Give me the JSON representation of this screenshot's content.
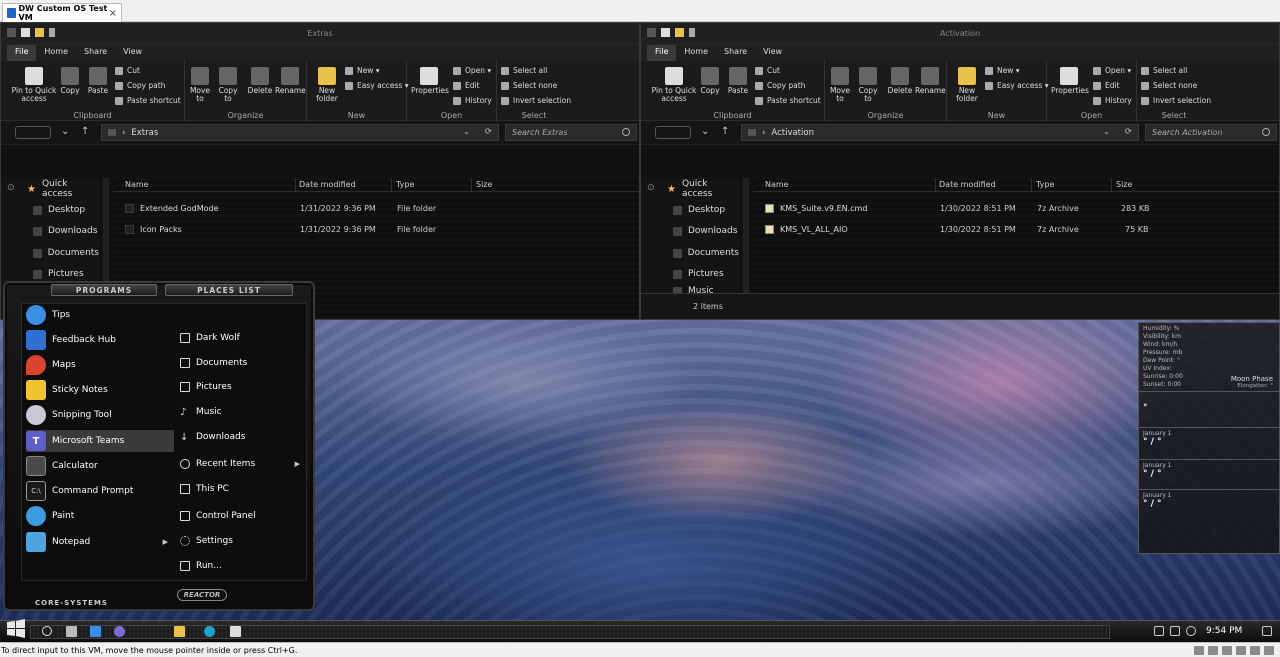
{
  "vm": {
    "tab_title": "DW Custom OS Test VM",
    "status_text": "To direct input to this VM, move the mouse pointer inside or press Ctrl+G."
  },
  "ribbon": {
    "tabs": [
      "File",
      "Home",
      "Share",
      "View"
    ],
    "clipboard": {
      "pin": "Pin to Quick access",
      "copy": "Copy",
      "paste": "Paste",
      "cut": "Cut",
      "copy_path": "Copy path",
      "paste_shortcut": "Paste shortcut",
      "label": "Clipboard"
    },
    "organize": {
      "move_to": "Move to",
      "copy_to": "Copy to",
      "delete": "Delete",
      "rename": "Rename",
      "label": "Organize"
    },
    "new": {
      "new_folder": "New folder",
      "new_item": "New ▾",
      "easy_access": "Easy access ▾",
      "label": "New"
    },
    "open": {
      "properties": "Properties",
      "open": "Open ▾",
      "edit": "Edit",
      "history": "History",
      "label": "Open"
    },
    "select": {
      "select_all": "Select all",
      "select_none": "Select none",
      "invert": "Invert selection",
      "label": "Select"
    }
  },
  "columns": {
    "name": "Name",
    "date": "Date modified",
    "type": "Type",
    "size": "Size"
  },
  "explorer_left": {
    "title": "Extras",
    "address": "Extras",
    "search_placeholder": "Search Extras",
    "nav": [
      "Quick access",
      "Desktop",
      "Downloads",
      "Documents",
      "Pictures"
    ],
    "files": [
      {
        "name": "Extended GodMode",
        "date": "1/31/2022 9:36 PM",
        "type": "File folder",
        "size": ""
      },
      {
        "name": "Icon Packs",
        "date": "1/31/2022 9:36 PM",
        "type": "File folder",
        "size": ""
      }
    ]
  },
  "explorer_right": {
    "title": "Activation",
    "address": "Activation",
    "search_placeholder": "Search Activation",
    "nav": [
      "Quick access",
      "Desktop",
      "Downloads",
      "Documents",
      "Pictures",
      "Music"
    ],
    "files": [
      {
        "name": "KMS_Suite.v9.EN.cmd",
        "date": "1/30/2022 8:51 PM",
        "type": "7z Archive",
        "size": "283 KB"
      },
      {
        "name": "KMS_VL_ALL_AIO",
        "date": "1/30/2022 8:51 PM",
        "type": "7z Archive",
        "size": "75 KB"
      }
    ],
    "status": "2 items"
  },
  "start_menu": {
    "tab_programs": "PROGRAMS",
    "tab_places": "PLACES LIST",
    "programs": [
      {
        "label": "Tips",
        "color": "#3a8ee6"
      },
      {
        "label": "Feedback Hub",
        "color": "#2f6fd1"
      },
      {
        "label": "Maps",
        "color": "#d9432f"
      },
      {
        "label": "Sticky Notes",
        "color": "#f2c530"
      },
      {
        "label": "Snipping Tool",
        "color": "#c9c9d6"
      },
      {
        "label": "Microsoft Teams",
        "color": "#5b5fc7"
      },
      {
        "label": "Calculator",
        "color": "#4a4a4a"
      },
      {
        "label": "Command Prompt",
        "color": "#1a1a1a"
      },
      {
        "label": "Paint",
        "color": "#3b9de0"
      },
      {
        "label": "Notepad",
        "color": "#4fa3e0"
      }
    ],
    "places": [
      "Dark Wolf",
      "Documents",
      "Pictures",
      "Music",
      "Downloads",
      "Recent Items",
      "This PC",
      "Control Panel",
      "Settings",
      "Run..."
    ],
    "footer": "CORE-SYSTEMS",
    "power_label": "REACTOR"
  },
  "gadget": {
    "lines": [
      "Humidity: %",
      "Visibility: km",
      "Wind: km/h",
      "Pressure: mb",
      "Dew Point: °",
      "UV Index:",
      "Sunrise: 0:00",
      "Sunset: 0:00"
    ],
    "moon_phase": "Moon Phase",
    "elongation": "Elongation: °",
    "current_temp": "°",
    "forecast": [
      {
        "date": "January 1",
        "temp": "° / °"
      },
      {
        "date": "January 1",
        "temp": "° / °"
      },
      {
        "date": "January 1",
        "temp": "° / °"
      }
    ]
  },
  "taskbar": {
    "clock": "9:54 PM"
  }
}
